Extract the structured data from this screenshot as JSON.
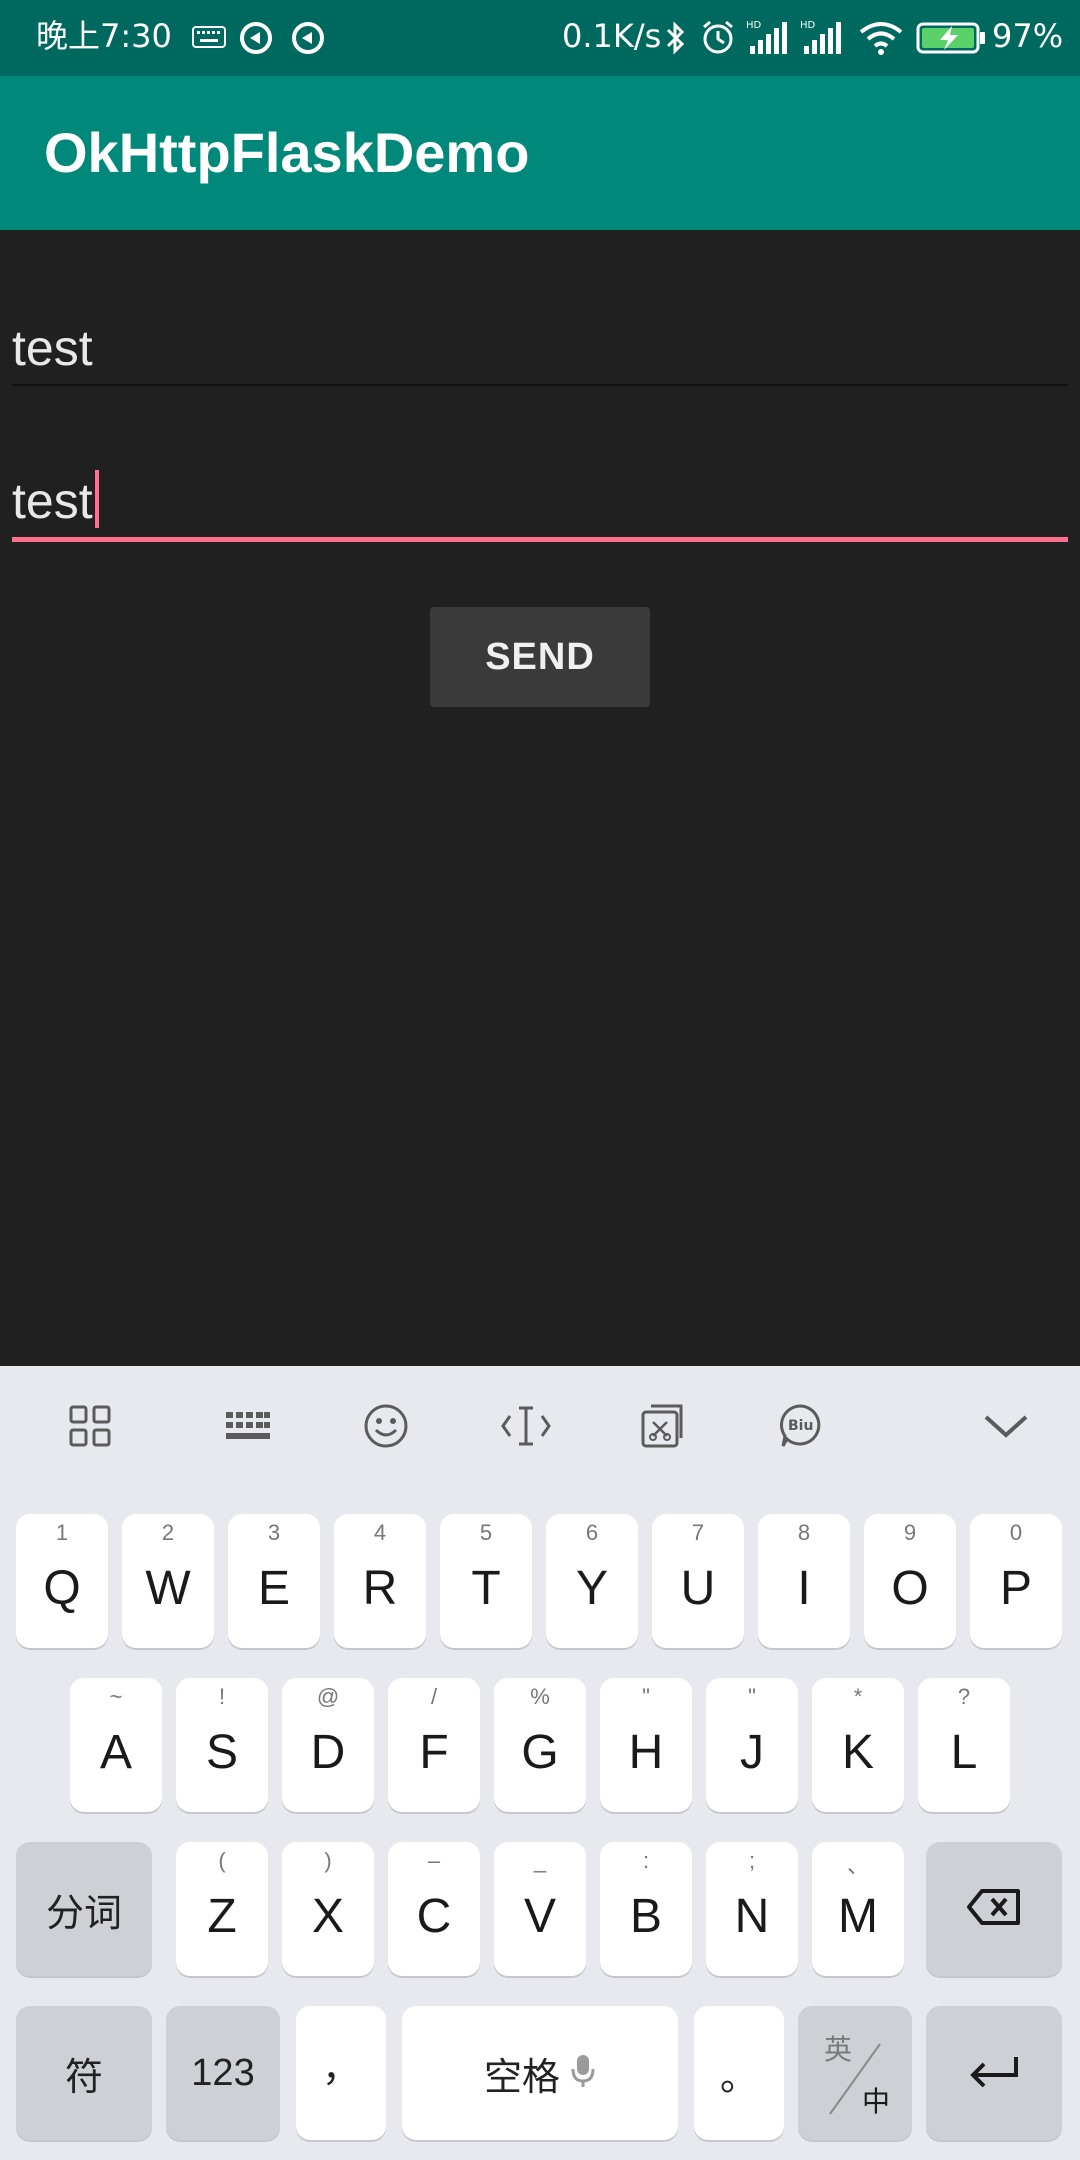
{
  "status_bar": {
    "time": "晚上7:30",
    "net_speed": "0.1K/s",
    "battery": "97%",
    "colors": {
      "background": "#00695f"
    },
    "icons": [
      "keyboard-icon",
      "sync-icon",
      "sync-icon",
      "bluetooth-icon",
      "alarm-icon",
      "hd-signal-icon",
      "hd-signal-icon",
      "wifi-icon",
      "battery-charging-icon"
    ]
  },
  "app_bar": {
    "title": "OkHttpFlaskDemo",
    "colors": {
      "background": "#00897b"
    }
  },
  "form": {
    "field1_value": "test",
    "field2_value": "test",
    "send_label": "SEND",
    "colors": {
      "focus_underline": "#ff6f8f",
      "background": "#202020"
    }
  },
  "keyboard": {
    "toolbar_icons": [
      "grid-icon",
      "keyboard-icon",
      "emoji-icon",
      "text-cursor-icon",
      "clipboard-icon",
      "biu-icon",
      "chevron-down-icon"
    ],
    "row1": [
      {
        "k": "Q",
        "h": "1"
      },
      {
        "k": "W",
        "h": "2"
      },
      {
        "k": "E",
        "h": "3"
      },
      {
        "k": "R",
        "h": "4"
      },
      {
        "k": "T",
        "h": "5"
      },
      {
        "k": "Y",
        "h": "6"
      },
      {
        "k": "U",
        "h": "7"
      },
      {
        "k": "I",
        "h": "8"
      },
      {
        "k": "O",
        "h": "9"
      },
      {
        "k": "P",
        "h": "0"
      }
    ],
    "row2": [
      {
        "k": "A",
        "h": "~"
      },
      {
        "k": "S",
        "h": "!"
      },
      {
        "k": "D",
        "h": "@"
      },
      {
        "k": "F",
        "h": "/"
      },
      {
        "k": "G",
        "h": "%"
      },
      {
        "k": "H",
        "h": "\""
      },
      {
        "k": "J",
        "h": "\""
      },
      {
        "k": "K",
        "h": "*"
      },
      {
        "k": "L",
        "h": "?"
      }
    ],
    "row3": [
      {
        "k": "Z",
        "h": "("
      },
      {
        "k": "X",
        "h": ")"
      },
      {
        "k": "C",
        "h": "–"
      },
      {
        "k": "V",
        "h": "_"
      },
      {
        "k": "B",
        "h": ":"
      },
      {
        "k": "N",
        "h": ";"
      },
      {
        "k": "M",
        "h": "、"
      }
    ],
    "segment_label": "分词",
    "symbols_label": "符",
    "numbers_label": "123",
    "comma_label": "，",
    "space_label": "空格",
    "period_label": "。",
    "lang_top": "英",
    "lang_bottom": "中"
  }
}
